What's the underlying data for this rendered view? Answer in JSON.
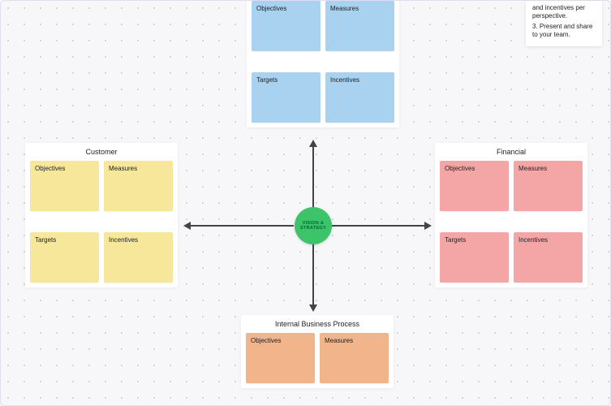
{
  "center": {
    "label": "VISION & STRATEGY"
  },
  "panels": {
    "top": {
      "title": "",
      "stickies": [
        "Objectives",
        "Measures",
        "Targets",
        "Incentives"
      ]
    },
    "left": {
      "title": "Customer",
      "stickies": [
        "Objectives",
        "Measures",
        "Targets",
        "Incentives"
      ]
    },
    "right": {
      "title": "Financial",
      "stickies": [
        "Objectives",
        "Measures",
        "Targets",
        "Incentives"
      ]
    },
    "bottom": {
      "title": "Internal Business Process",
      "stickies": [
        "Objectives",
        "Measures"
      ]
    }
  },
  "instructions": {
    "line1": "and incentives per perspective.",
    "line2": "3. Present and share to your team."
  },
  "colors": {
    "top_sticky": "#a9d1f0",
    "left_sticky": "#f6e79a",
    "right_sticky": "#f4a6a6",
    "bottom_sticky": "#f2b48a",
    "center": "#3dc46a"
  }
}
